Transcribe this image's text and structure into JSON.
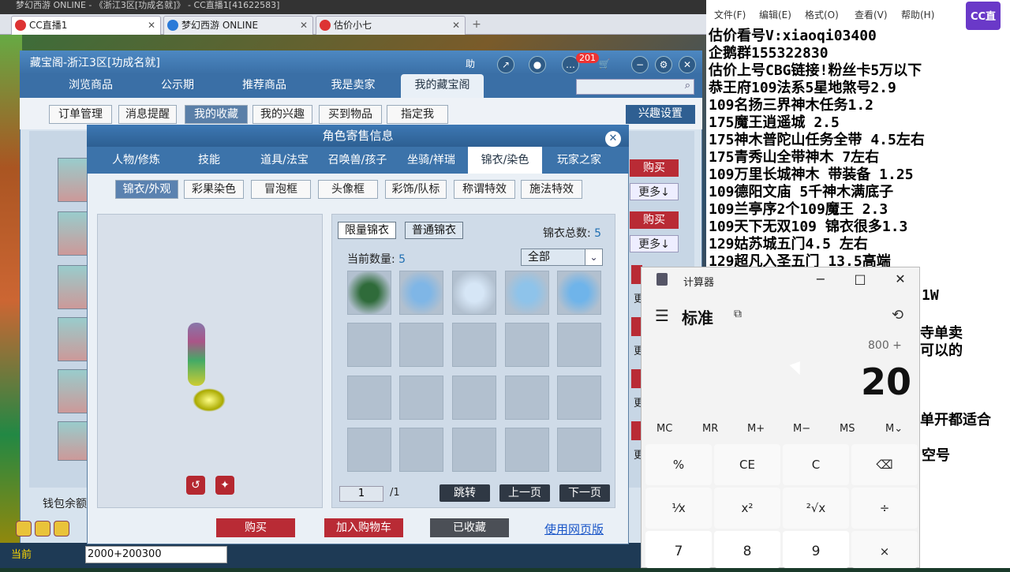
{
  "browser": {
    "top_text": "梦幻西游 ONLINE - 《浙江3区[功成名就]》 - CC直播1[41622583]",
    "tabs": [
      {
        "label": "CC直播1"
      },
      {
        "label": "梦幻西游 ONLINE"
      },
      {
        "label": "估价小七"
      }
    ],
    "new_tab": "+"
  },
  "cbg": {
    "title": "藏宝阁-浙江3区[功成名就]",
    "help": "助",
    "notify_count": "201",
    "nav": [
      "浏览商品",
      "公示期",
      "推荐商品",
      "我是卖家",
      "我的藏宝阁"
    ],
    "subnav": [
      "订单管理",
      "消息提醒",
      "我的收藏",
      "我的兴趣",
      "买到物品",
      "指定我"
    ],
    "interest_settings": "兴趣设置",
    "buy": "购买",
    "more": "更多↓",
    "side_more": "更",
    "wallet": "钱包余额",
    "current": "当前",
    "chat_input": "2000+200300"
  },
  "modal": {
    "title": "角色寄售信息",
    "close": "✕",
    "tabs": [
      "人物/修炼",
      "技能",
      "道具/法宝",
      "召唤兽/孩子",
      "坐骑/祥瑞",
      "锦衣/染色",
      "玩家之家"
    ],
    "subtabs": [
      "锦衣/外观",
      "彩果染色",
      "冒泡框",
      "头像框",
      "彩饰/队标",
      "称谓特效",
      "施法特效"
    ],
    "kind_limited": "限量锦衣",
    "kind_normal": "普通锦衣",
    "total_label": "锦衣总数:",
    "total_value": "5",
    "current_label": "当前数量:",
    "current_value": "5",
    "filter": "全部",
    "page_current": "1",
    "page_total": "/1",
    "jump": "跳转",
    "prev": "上一页",
    "next": "下一页",
    "buy": "购买",
    "add_cart": "加入购物车",
    "favorited": "已收藏",
    "web_version": "使用网页版"
  },
  "notepad": {
    "menu": [
      "文件(F)",
      "编辑(E)",
      "格式(O)",
      "查看(V)",
      "帮助(H)"
    ],
    "logo": "CC直播",
    "lines": [
      "估价看号V:xiaoqi03400",
      "企鹅群155322830",
      "估价上号CBG链接!粉丝卡5万以下",
      "恭王府109法系5星地煞号2.9",
      "109名扬三界神木任务1.2",
      "175魔王逍遥城 2.5",
      "175神木普陀山任务全带 4.5左右",
      "175青秀山全带神木  7左右",
      "109万里长城神木 带装备  1.25",
      "109德阳文庙 5千神木满底子",
      "109兰亭序2个109魔王 2.3",
      "109天下无双109  锦衣很多1.3",
      "129姑苏城五门4.5 左右",
      "129超凡入圣五门  13.5高端"
    ],
    "cut_lines": [
      "1W",
      "寺单卖",
      "可以的",
      "单开都适合",
      "空号"
    ]
  },
  "calculator": {
    "title": "计算器",
    "mode": "标准",
    "expression": "800 +",
    "result": "20",
    "memory": [
      "MC",
      "MR",
      "M+",
      "M−",
      "MS",
      "M⌄"
    ],
    "keys": [
      "%",
      "CE",
      "C",
      "⌫",
      "¹⁄x",
      "x²",
      "²√x",
      "÷",
      "7",
      "8",
      "9",
      "×"
    ]
  }
}
